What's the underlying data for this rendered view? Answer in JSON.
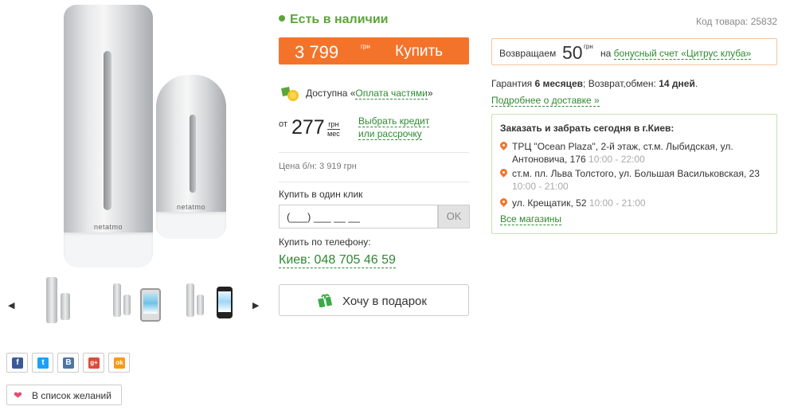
{
  "availability": "Есть в наличии",
  "buy": {
    "price": "3 799",
    "currency": "грн",
    "label": "Купить"
  },
  "installments": {
    "prefix": "Доступна «",
    "link": "Оплата частями",
    "suffix": "»"
  },
  "credit": {
    "from": "от",
    "amount": "277",
    "unit_top": "грн",
    "unit_bottom": "мес",
    "link_line1": "Выбрать кредит",
    "link_line2": "или рассрочку"
  },
  "cashless_price": "Цена б/н: 3 919 грн",
  "one_click": {
    "label": "Купить в один клик",
    "placeholder": "(___) ___ __ __",
    "ok": "OK"
  },
  "phone_order": {
    "label": "Купить по телефону:",
    "number": "Киев: 048 705 46 59"
  },
  "gift_button": "Хочу в подарок",
  "product_code": "Код товара: 25832",
  "cashback": {
    "prefix": "Возвращаем",
    "amount": "50",
    "currency": "грн",
    "on": "на",
    "link": "бонусный счет «Цитрус клуба»"
  },
  "warranty": {
    "t1": "Гарантия ",
    "b1": "6 месяцев",
    "t2": "; Возврат,обмен: ",
    "b2": "14 дней",
    "t3": "."
  },
  "delivery_link": "Подробнее о доставке »",
  "pickup": {
    "title": "Заказать и забрать сегодня в г.Киев:",
    "stores": [
      {
        "address": "ТРЦ \"Ocean Plaza\", 2-й этаж, ст.м. Лыбидская, ул. Антоновича, 176",
        "hours": "10:00 - 22:00"
      },
      {
        "address": "ст.м. пл. Льва Толстого, ул. Большая Васильковская, 23",
        "hours": "10:00 - 21:00"
      },
      {
        "address": "ул. Крещатик, 52",
        "hours": "10:00 - 21:00"
      }
    ],
    "all_link": "Все магазины"
  },
  "brand_text": "netatmo",
  "thumbs": {
    "prev": "◀",
    "next": "▶"
  },
  "social": [
    {
      "icon": "facebook-icon",
      "glyph": "f",
      "color": "#3b5998"
    },
    {
      "icon": "twitter-icon",
      "glyph": "t",
      "color": "#1da1f2"
    },
    {
      "icon": "vk-icon",
      "glyph": "B",
      "color": "#4c75a3"
    },
    {
      "icon": "google-plus-icon",
      "glyph": "g+",
      "color": "#dd4b39"
    },
    {
      "icon": "odnoklassniki-icon",
      "glyph": "ok",
      "color": "#f59a1a"
    }
  ],
  "wishlist": "В список желаний",
  "colors": {
    "accent": "#f3732b",
    "green": "#5da53a",
    "link": "#2e8a30"
  }
}
